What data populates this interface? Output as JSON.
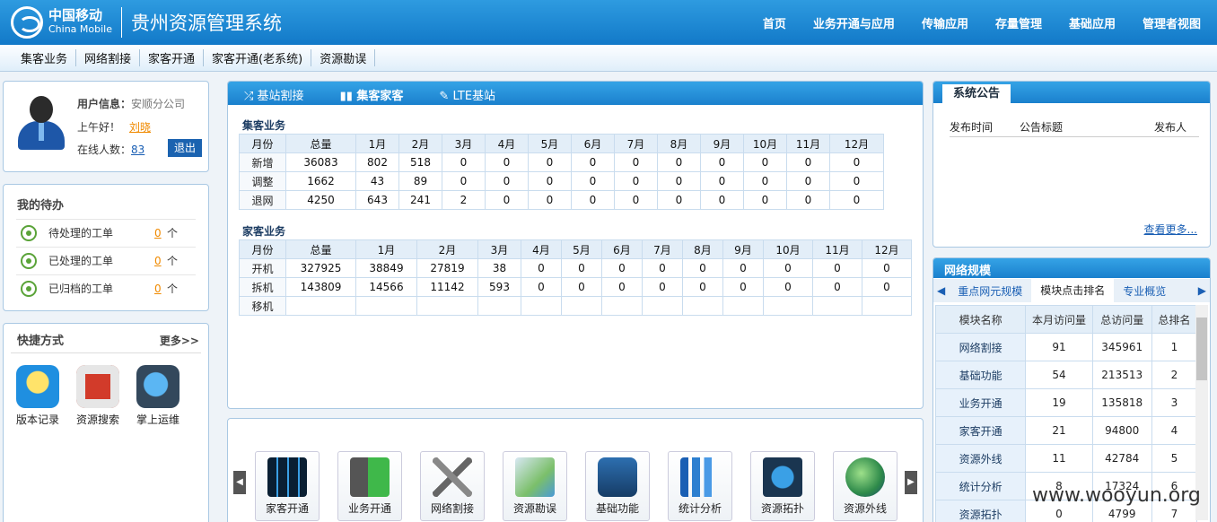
{
  "header": {
    "logo_cn": "中国移动",
    "logo_en": "China Mobile",
    "system_title": "贵州资源管理系统",
    "nav": [
      "首页",
      "业务开通与应用",
      "传输应用",
      "存量管理",
      "基础应用",
      "管理者视图"
    ]
  },
  "subnav": [
    "集客业务",
    "网络割接",
    "家客开通",
    "家客开通(老系统)",
    "资源勘误"
  ],
  "user": {
    "title": "用户信息：",
    "company": "安顺分公司",
    "greeting": "上午好！",
    "name": "刘晓",
    "online_label": "在线人数：",
    "online_count": "83",
    "logout": "退出"
  },
  "todo": {
    "title": "我的待办",
    "items": [
      {
        "label": "待处理的工单",
        "count": "0",
        "unit": "个"
      },
      {
        "label": "已处理的工单",
        "count": "0",
        "unit": "个"
      },
      {
        "label": "已归档的工单",
        "count": "0",
        "unit": "个"
      }
    ]
  },
  "shortcut": {
    "title": "快捷方式",
    "more": "更多>>",
    "items": [
      "版本记录",
      "资源搜索",
      "掌上运维"
    ]
  },
  "tabs": [
    "基站割接",
    "集客家客",
    "LTE基站"
  ],
  "jike": {
    "title": "集客业务",
    "header": [
      "月份",
      "总量",
      "1月",
      "2月",
      "3月",
      "4月",
      "5月",
      "6月",
      "7月",
      "8月",
      "9月",
      "10月",
      "11月",
      "12月"
    ],
    "rows": [
      [
        "新增",
        "36083",
        "802",
        "518",
        "0",
        "0",
        "0",
        "0",
        "0",
        "0",
        "0",
        "0",
        "0",
        "0"
      ],
      [
        "调整",
        "1662",
        "43",
        "89",
        "0",
        "0",
        "0",
        "0",
        "0",
        "0",
        "0",
        "0",
        "0",
        "0"
      ],
      [
        "退网",
        "4250",
        "643",
        "241",
        "2",
        "0",
        "0",
        "0",
        "0",
        "0",
        "0",
        "0",
        "0",
        "0"
      ]
    ]
  },
  "jiake": {
    "title": "家客业务",
    "header": [
      "月份",
      "总量",
      "1月",
      "2月",
      "3月",
      "4月",
      "5月",
      "6月",
      "7月",
      "8月",
      "9月",
      "10月",
      "11月",
      "12月"
    ],
    "rows": [
      [
        "开机",
        "327925",
        "38849",
        "27819",
        "38",
        "0",
        "0",
        "0",
        "0",
        "0",
        "0",
        "0",
        "0",
        "0"
      ],
      [
        "拆机",
        "143809",
        "14566",
        "11142",
        "593",
        "0",
        "0",
        "0",
        "0",
        "0",
        "0",
        "0",
        "0",
        "0"
      ],
      [
        "移机",
        "",
        "",
        "",
        "",
        "",
        "",
        "",
        "",
        "",
        "",
        "",
        "",
        ""
      ]
    ]
  },
  "apps": [
    "家客开通",
    "业务开通",
    "网络割接",
    "资源勘误",
    "基础功能",
    "统计分析",
    "资源拓扑",
    "资源外线"
  ],
  "notice": {
    "tab": "系统公告",
    "cols": [
      "发布时间",
      "公告标题",
      "发布人"
    ],
    "more": "查看更多..."
  },
  "network": {
    "title": "网络规模",
    "tabs": [
      "重点网元规模",
      "模块点击排名",
      "专业概览"
    ],
    "header": [
      "模块名称",
      "本月访问量",
      "总访问量",
      "总排名"
    ],
    "rows": [
      [
        "网络割接",
        "91",
        "345961",
        "1"
      ],
      [
        "基础功能",
        "54",
        "213513",
        "2"
      ],
      [
        "业务开通",
        "19",
        "135818",
        "3"
      ],
      [
        "家客开通",
        "21",
        "94800",
        "4"
      ],
      [
        "资源外线",
        "11",
        "42784",
        "5"
      ],
      [
        "统计分析",
        "8",
        "17324",
        "6"
      ],
      [
        "资源拓扑",
        "0",
        "4799",
        "7"
      ]
    ]
  },
  "watermark": "www.wooyun.org",
  "colors": {
    "header": "#1a80cd",
    "accent": "#f08a00",
    "link": "#1a5fb4"
  }
}
